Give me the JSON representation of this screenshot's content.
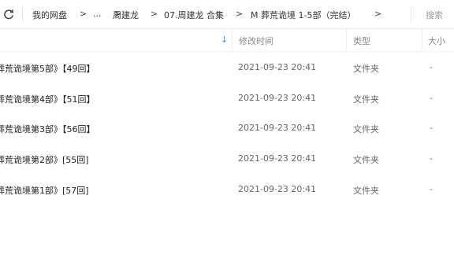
{
  "toolbar": {
    "refresh_icon": "refresh-icon",
    "breadcrumbs": [
      "我的网盘",
      "...",
      "周建龙",
      "07.周建龙 合集",
      "M 葬荒诡境 1-5部（完结）"
    ],
    "separator": ">",
    "search_placeholder": "搜索"
  },
  "columns": {
    "name": "",
    "modified": "修改时间",
    "type": "类型",
    "size": "大小",
    "sort_icon": "sort-down-arrow-icon",
    "sort_color": "#4f8fe6"
  },
  "rows": [
    {
      "name": "葬荒诡境第5部》【49回】",
      "modified": "2021-09-23 20:41",
      "type": "文件夹",
      "size": "-"
    },
    {
      "name": "葬荒诡境第4部》【51回】",
      "modified": "2021-09-23 20:41",
      "type": "文件夹",
      "size": "-"
    },
    {
      "name": "葬荒诡境第3部》【56回】",
      "modified": "2021-09-23 20:41",
      "type": "文件夹",
      "size": "-"
    },
    {
      "name": "葬荒诡境第2部》[55回]",
      "modified": "2021-09-23 20:41",
      "type": "文件夹",
      "size": "-"
    },
    {
      "name": "葬荒诡境第1部》[57回]",
      "modified": "2021-09-23 20:41",
      "type": "文件夹",
      "size": "-"
    }
  ]
}
